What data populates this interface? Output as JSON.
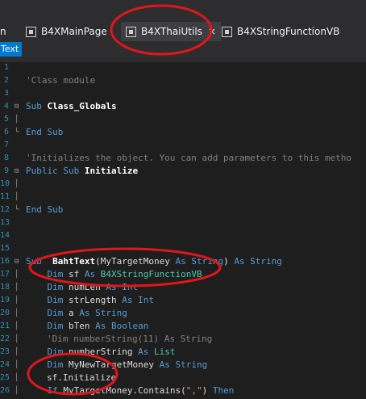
{
  "tabs": [
    {
      "label": "n",
      "active": false
    },
    {
      "label": "B4XMainPage",
      "active": false
    },
    {
      "label": "B4XThaiUtils",
      "active": true,
      "close": "×"
    },
    {
      "label": "B4XStringFunctionVB",
      "active": false
    }
  ],
  "sub_tab": {
    "label": "Text"
  },
  "lines": [
    {
      "n": "1",
      "text": ""
    },
    {
      "n": "2",
      "text": "'Class module"
    },
    {
      "n": "3",
      "text": ""
    },
    {
      "n": "4",
      "text": "Sub Class_Globals"
    },
    {
      "n": "5",
      "text": ""
    },
    {
      "n": "6",
      "text": "End Sub"
    },
    {
      "n": "7",
      "text": ""
    },
    {
      "n": "8",
      "text": "'Initializes the object. You can add parameters to this metho"
    },
    {
      "n": "9",
      "text": "Public Sub Initialize"
    },
    {
      "n": "10",
      "text": ""
    },
    {
      "n": "11",
      "text": ""
    },
    {
      "n": "12",
      "text": "End Sub"
    },
    {
      "n": "13",
      "text": ""
    },
    {
      "n": "14",
      "text": ""
    },
    {
      "n": "15",
      "text": ""
    },
    {
      "n": "16",
      "text": "Sub  BahtText(MyTargetMoney As String) As String"
    },
    {
      "n": "17",
      "text": "Dim sf As B4XStringFunctionVB"
    },
    {
      "n": "18",
      "text": "Dim numLen As Int"
    },
    {
      "n": "19",
      "text": "Dim strLength As Int"
    },
    {
      "n": "20",
      "text": "Dim a As String"
    },
    {
      "n": "21",
      "text": "Dim bTen As Boolean"
    },
    {
      "n": "22",
      "text": "'Dim numberString(11) As String"
    },
    {
      "n": "23",
      "text": "Dim numberString As List"
    },
    {
      "n": "24",
      "text": "Dim MyNewTargetMoney As String"
    },
    {
      "n": "25",
      "text": "sf.Initialize"
    },
    {
      "n": "26",
      "text": "If MyTargetMoney.Contains(\",\") Then"
    }
  ],
  "colors": {
    "keyword": "#569cd6",
    "comment": "#808080",
    "type": "#4ec9b0",
    "line_number": "#2b91af",
    "annotation": "#e0161a"
  }
}
